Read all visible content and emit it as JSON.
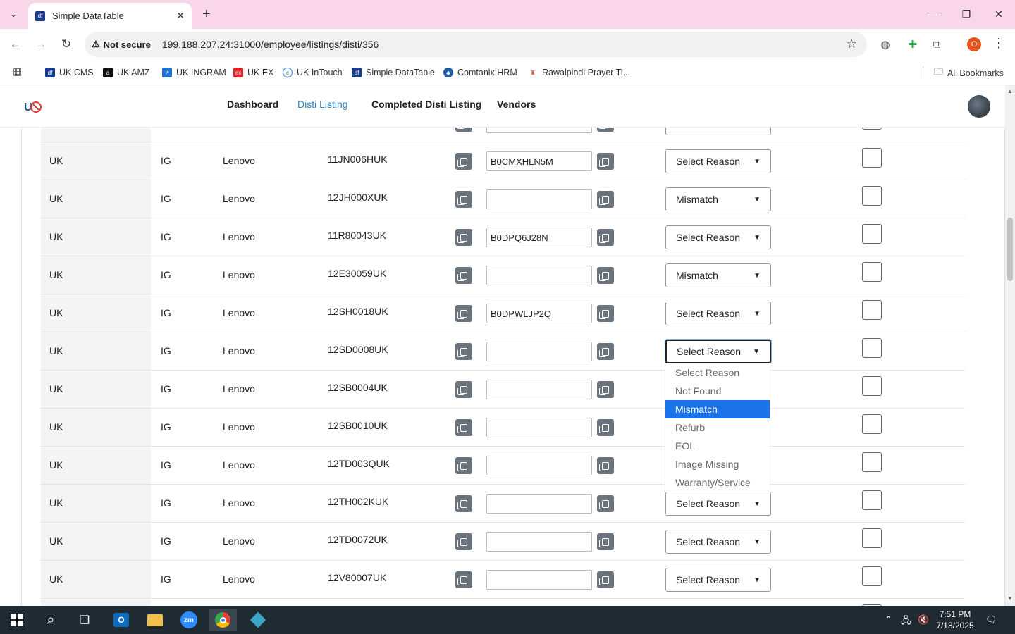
{
  "browser": {
    "tab_title": "Simple DataTable",
    "security_label": "Not secure",
    "url": "199.188.207.24:31000/employee/listings/disti/356",
    "profile_initial": "O",
    "bookmarks": [
      "UK CMS",
      "UK AMZ",
      "UK INGRAM",
      "UK EX",
      "UK InTouch",
      "Simple DataTable",
      "Comtanix HRM",
      "Rawalpindi Prayer Ti..."
    ],
    "all_bookmarks": "All Bookmarks"
  },
  "nav": {
    "links": [
      "Dashboard",
      "Disti Listing",
      "Completed Disti Listing",
      "Vendors"
    ],
    "active": "Disti Listing"
  },
  "table": {
    "rows": [
      {
        "country": "UK",
        "dist": "IG",
        "brand": "Lenovo",
        "sku": "11JN006HUK",
        "asin": "B0CMXHLN5M",
        "reason": "Select Reason"
      },
      {
        "country": "UK",
        "dist": "IG",
        "brand": "Lenovo",
        "sku": "12JH000XUK",
        "asin": "",
        "reason": "Mismatch"
      },
      {
        "country": "UK",
        "dist": "IG",
        "brand": "Lenovo",
        "sku": "11R80043UK",
        "asin": "B0DPQ6J28N",
        "reason": "Select Reason"
      },
      {
        "country": "UK",
        "dist": "IG",
        "brand": "Lenovo",
        "sku": "12E30059UK",
        "asin": "",
        "reason": "Mismatch"
      },
      {
        "country": "UK",
        "dist": "IG",
        "brand": "Lenovo",
        "sku": "12SH0018UK",
        "asin": "B0DPWLJP2Q",
        "reason": "Select Reason"
      },
      {
        "country": "UK",
        "dist": "IG",
        "brand": "Lenovo",
        "sku": "12SD0008UK",
        "asin": "",
        "reason": "Select Reason"
      },
      {
        "country": "UK",
        "dist": "IG",
        "brand": "Lenovo",
        "sku": "12SB0004UK",
        "asin": "",
        "reason": ""
      },
      {
        "country": "UK",
        "dist": "IG",
        "brand": "Lenovo",
        "sku": "12SB0010UK",
        "asin": "",
        "reason": ""
      },
      {
        "country": "UK",
        "dist": "IG",
        "brand": "Lenovo",
        "sku": "12TD003QUK",
        "asin": "",
        "reason": ""
      },
      {
        "country": "UK",
        "dist": "IG",
        "brand": "Lenovo",
        "sku": "12TH002KUK",
        "asin": "",
        "reason": "Select Reason"
      },
      {
        "country": "UK",
        "dist": "IG",
        "brand": "Lenovo",
        "sku": "12TD0072UK",
        "asin": "",
        "reason": "Select Reason"
      },
      {
        "country": "UK",
        "dist": "IG",
        "brand": "Lenovo",
        "sku": "12V80007UK",
        "asin": "",
        "reason": "Select Reason"
      }
    ]
  },
  "dropdown": {
    "options": [
      "Select Reason",
      "Not Found",
      "Mismatch",
      "Refurb",
      "EOL",
      "Image Missing",
      "Warranty/Service"
    ],
    "highlighted": "Mismatch"
  },
  "taskbar": {
    "time": "7:51 PM",
    "date": "7/18/2025"
  }
}
